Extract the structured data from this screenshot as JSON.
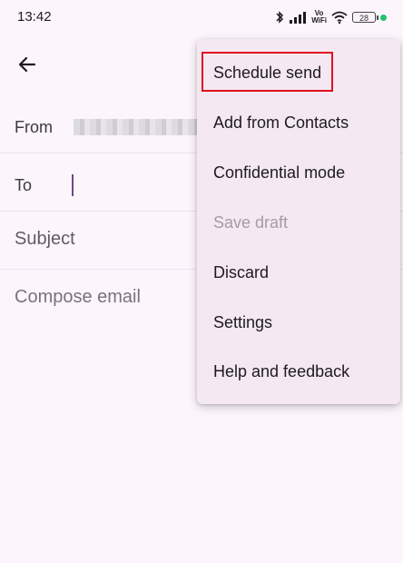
{
  "status_bar": {
    "time": "13:42",
    "vowifi_top": "Vo",
    "vowifi_bottom": "WiFi",
    "battery": "28"
  },
  "compose": {
    "from_label": "From",
    "to_label": "To",
    "subject_placeholder": "Subject",
    "body_placeholder": "Compose email"
  },
  "menu": {
    "items": [
      {
        "label": "Schedule send"
      },
      {
        "label": "Add from Contacts"
      },
      {
        "label": "Confidential mode"
      },
      {
        "label": "Save draft"
      },
      {
        "label": "Discard"
      },
      {
        "label": "Settings"
      },
      {
        "label": "Help and feedback"
      }
    ]
  },
  "colors": {
    "background": "#fdf5fc",
    "menu_background": "#f4e8f2",
    "highlight": "#e0101f",
    "cursor": "#6c4a87"
  }
}
